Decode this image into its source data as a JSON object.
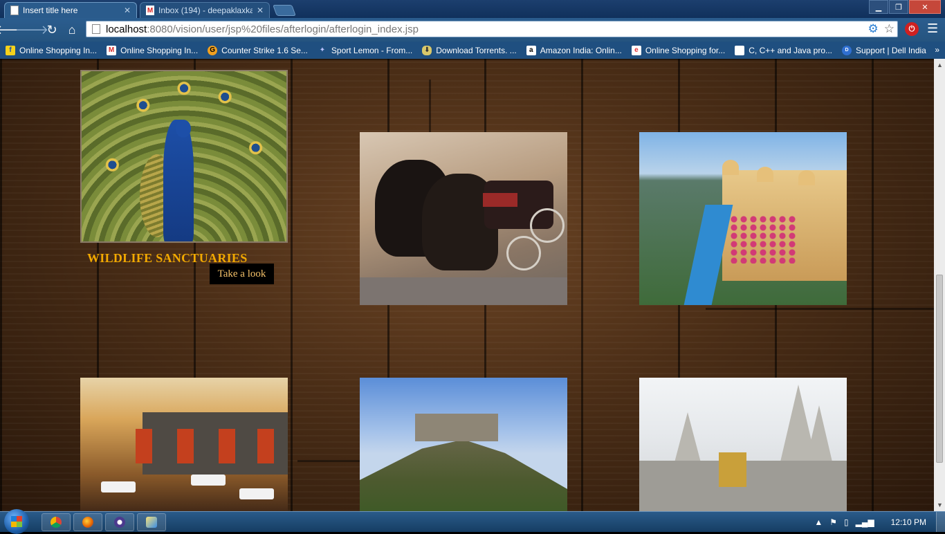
{
  "browser": {
    "tabs": [
      {
        "title": "Insert title here",
        "active": true
      },
      {
        "title": "Inbox (194) - deepaklaxkar",
        "active": false
      }
    ],
    "url": {
      "host": "localhost",
      "path": ":8080/vision/user/jsp%20files/afterlogin/afterlogin_index.jsp"
    },
    "bookmarks": [
      {
        "label": "Online Shopping In...",
        "icon": "flipkart-icon",
        "color": "#f6d21b"
      },
      {
        "label": "Online Shopping In...",
        "icon": "myntra-icon",
        "color": "#d62b2b"
      },
      {
        "label": "Counter Strike 1.6 Se...",
        "icon": "cs-icon",
        "color": "#f0a020"
      },
      {
        "label": "Sport Lemon - From...",
        "icon": "sportlemon-icon",
        "color": "#6a7bd8"
      },
      {
        "label": "Download Torrents. ...",
        "icon": "torrent-icon",
        "color": "#d9c86a"
      },
      {
        "label": "Amazon India: Onlin...",
        "icon": "amazon-icon",
        "color": "#ffffff"
      },
      {
        "label": "Online Shopping for...",
        "icon": "ebay-icon",
        "color": "#e53238"
      },
      {
        "label": "C, C++ and Java pro...",
        "icon": "page-icon",
        "color": "#ffffff"
      },
      {
        "label": "Support | Dell India",
        "icon": "dell-icon",
        "color": "#2f6fd1"
      }
    ]
  },
  "page": {
    "feature": {
      "title": "WILDLIFE SANCTUARIES",
      "button": "Take a look"
    },
    "colors": {
      "caption": "#f2a900",
      "button_text": "#f7c36a",
      "button_bg": "#000000"
    }
  },
  "taskbar": {
    "clock": "12:10 PM",
    "apps": [
      "chrome-icon",
      "firefox-icon",
      "eclipse-icon",
      "paint-icon"
    ]
  }
}
